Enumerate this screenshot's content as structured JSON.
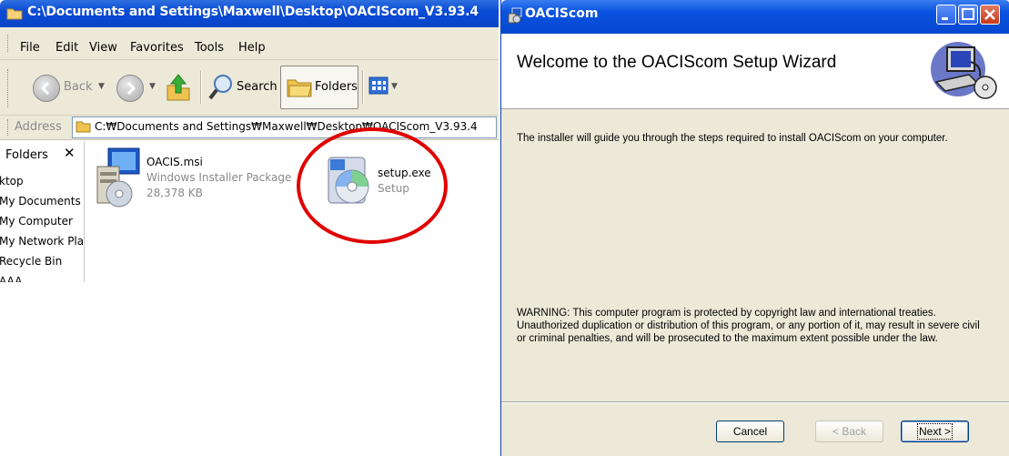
{
  "explorer": {
    "title": "C:\\Documents and Settings\\Maxwell\\Desktop\\OACIScom_V3.93.4",
    "menu": [
      "File",
      "Edit",
      "View",
      "Favorites",
      "Tools",
      "Help"
    ],
    "toolbar": {
      "back_label": "Back",
      "search_label": "Search",
      "folders_label": "Folders"
    },
    "address": {
      "label": "Address",
      "value": "C:₩Documents and Settings₩Maxwell₩Desktop₩OACIScom_V3.93.4"
    },
    "folders_pane": {
      "title": "Folders",
      "close_glyph": "✕",
      "items": [
        "ktop",
        "My Documents",
        "My Computer",
        "My Network Places",
        "Recycle Bin",
        "AAA"
      ]
    },
    "files": [
      {
        "name": "OACIS.msi",
        "type": "Windows Installer Package",
        "size": "28,378 KB",
        "icon": "msi-package-icon"
      },
      {
        "name": "setup.exe",
        "type": "Setup",
        "icon": "setup-cd-icon"
      }
    ]
  },
  "wizard": {
    "title": "OACIScom",
    "heading": "Welcome to the OACIScom Setup Wizard",
    "intro": "The installer will guide you through the steps required to install OACIScom on your computer.",
    "warning_lines": [
      "WARNING: This computer program is protected by copyright law and international treaties.",
      "Unauthorized duplication or distribution of this program, or any portion of it, may result in severe civil",
      "or criminal penalties, and will be prosecuted to the maximum extent possible under the law."
    ],
    "buttons": {
      "cancel": "Cancel",
      "back": "< Back",
      "next": "Next >"
    }
  }
}
